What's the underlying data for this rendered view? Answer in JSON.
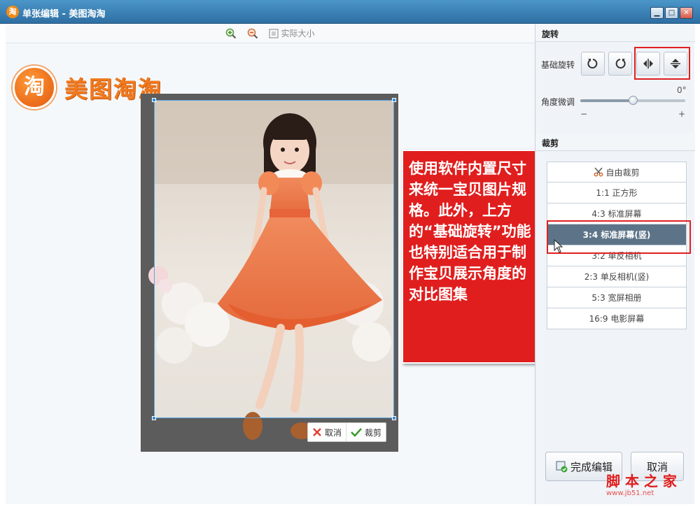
{
  "window": {
    "icon_glyph": "淘",
    "title": "单张编辑 - 美图淘淘",
    "min_glyph": "▁",
    "max_glyph": "□",
    "close_glyph": "✕"
  },
  "zoombar": {
    "zoom_in_icon": "zoom-in-icon",
    "zoom_out_icon": "zoom-out-icon",
    "actual_size_label": "实际大小"
  },
  "logo": {
    "glyph": "淘",
    "text": "美图淘淘"
  },
  "crop_actions": {
    "cancel_label": "取消",
    "confirm_label": "裁剪"
  },
  "callout": {
    "text": "使用软件内置尺寸来统一宝贝图片规格。此外，上方的“基础旋转”功能也特别适合用于制作宝贝展示角度的对比图集"
  },
  "rotate": {
    "section_title": "旋转",
    "basic_label": "基础旋转",
    "angle_label": "角度微调",
    "angle_value": "0°",
    "angle_fraction": 0.5,
    "minus": "−",
    "plus": "+"
  },
  "crop": {
    "section_title": "裁剪",
    "options": [
      {
        "label": "自由裁剪"
      },
      {
        "label": "1:1 正方形"
      },
      {
        "label": "4:3 标准屏幕"
      },
      {
        "label": "3:4 标准屏幕(竖)"
      },
      {
        "label": "3:2 单反相机"
      },
      {
        "label": "2:3 单反相机(竖)"
      },
      {
        "label": "5:3 宽屏相册"
      },
      {
        "label": "16:9 电影屏幕"
      }
    ],
    "selected_index": 3
  },
  "footer": {
    "done_label": "完成编辑",
    "cancel_label": "取消"
  },
  "watermark": {
    "text": "脚 本 之 家",
    "url": "www.jb51.net"
  },
  "colors": {
    "accent": "#e01e1e",
    "selected": "#5d7488",
    "titlebar": "#3b82b8"
  }
}
